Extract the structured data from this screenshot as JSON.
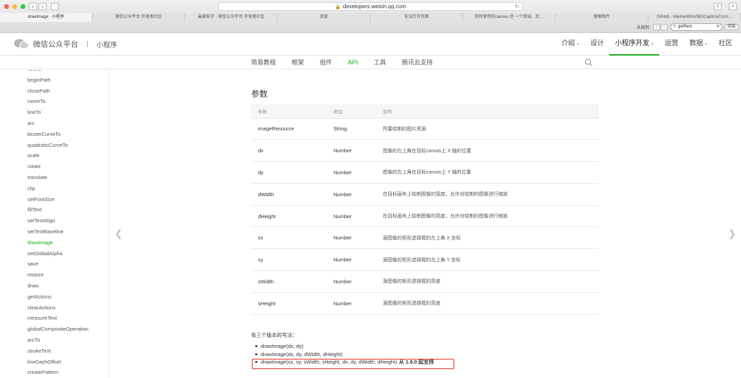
{
  "browser": {
    "url": "developers.weixin.qq.com",
    "tabs": [
      "drawImage · 小程序",
      "微信公众平台 开发者社区",
      "最爱帖子 · 微信公众平台 开发者社区",
      "百度",
      "无法打开页面",
      "你所使用的canvas 还 一个错误，另…",
      "搜索图片",
      "GitHub - MeimeiWhin/MGCaptureConn…"
    ],
    "active_tab": 0,
    "find": {
      "label": "未找到",
      "query": "getRect",
      "done_label": "完成"
    }
  },
  "header": {
    "brand": "微信公众平台",
    "section": "小程序",
    "nav": [
      {
        "label": "介绍",
        "caret": true
      },
      {
        "label": "设计",
        "caret": false
      },
      {
        "label": "小程序开发",
        "caret": true,
        "active": true
      },
      {
        "label": "运营",
        "caret": false
      },
      {
        "label": "数据",
        "caret": true
      },
      {
        "label": "社区",
        "caret": false
      }
    ]
  },
  "subnav": {
    "items": [
      "简易教程",
      "框架",
      "组件",
      "API",
      "工具",
      "腾讯云支持"
    ],
    "active": 3
  },
  "sidebar": {
    "items": [
      "stroke",
      "beginPath",
      "closePath",
      "moveTo",
      "lineTo",
      "arc",
      "bezierCurveTo",
      "quadraticCurveTo",
      "scale",
      "rotate",
      "translate",
      "clip",
      "setFontSize",
      "fillText",
      "setTextAlign",
      "setTextBaseline",
      "drawImage",
      "setGlobalAlpha",
      "save",
      "restore",
      "draw",
      "getActions",
      "clearActions",
      "measureText",
      "globalCompositeOperation",
      "arcTo",
      "strokeText",
      "lineDashOffset",
      "createPattern"
    ],
    "active": 16
  },
  "content": {
    "heading": "参数",
    "table": {
      "headers": [
        "参数",
        "类型",
        "说明"
      ],
      "rows": [
        [
          "imageResource",
          "String",
          "所要绘制的图片资源"
        ],
        [
          "dx",
          "Number",
          "图像的左上角在目标canvas上 X 轴的位置"
        ],
        [
          "dy",
          "Number",
          "图像的左上角在目标canvas上 Y 轴的位置"
        ],
        [
          "dWidth",
          "Number",
          "在目标画布上绘制图像的宽度，允许对绘制的图像进行缩放"
        ],
        [
          "dHeight",
          "Number",
          "在目标画布上绘制图像的高度，允许对绘制的图像进行缩放"
        ],
        [
          "sx",
          "Number",
          "源图像的矩形选择框的左上角 X 坐标"
        ],
        [
          "sy",
          "Number",
          "源图像的矩形选择框的左上角 Y 坐标"
        ],
        [
          "sWidth",
          "Number",
          "源图像的矩形选择框的高度"
        ],
        [
          "sHeight",
          "Number",
          "源图像的矩形选择框的高度"
        ]
      ]
    },
    "note": "有三个版本的写法：",
    "usages": [
      {
        "text": "drawImage(dx, dy)",
        "since": ""
      },
      {
        "text": "drawImage(dx, dy, dWidth, dHeight)",
        "since": ""
      },
      {
        "text": "drawImage(sx, sy, sWidth, sHeight, dx, dy, dWidth, dHeight)",
        "since": "从 1.9.0 起支持"
      }
    ],
    "highlight_color": "#e0301e"
  },
  "colors": {
    "accent": "#1aad19"
  }
}
